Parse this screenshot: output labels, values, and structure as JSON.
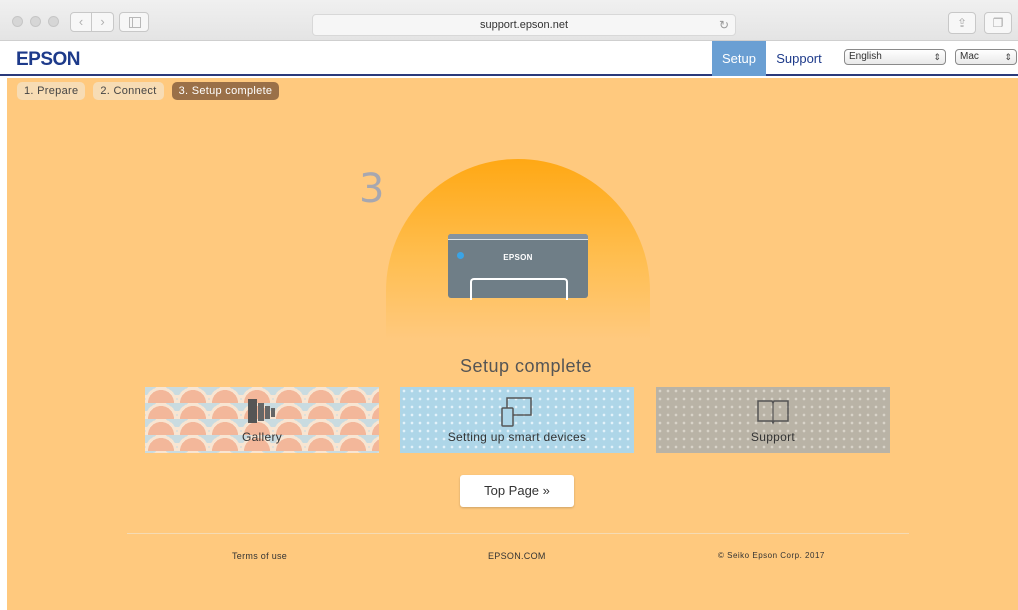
{
  "browser": {
    "url": "support.epson.net"
  },
  "header": {
    "logo": "EPSON",
    "tabs": [
      {
        "label": "Setup",
        "active": true
      },
      {
        "label": "Support",
        "active": false
      }
    ],
    "language_select": "English",
    "os_select": "Mac"
  },
  "steps": [
    {
      "label": "1. Prepare",
      "active": false
    },
    {
      "label": "2. Connect",
      "active": false
    },
    {
      "label": "3. Setup complete",
      "active": true
    }
  ],
  "hero": {
    "step_number": "3",
    "printer_label": "EPSON",
    "heading": "Setup complete"
  },
  "tiles": [
    {
      "label": "Gallery",
      "icon": "gallery-icon"
    },
    {
      "label": "Setting up smart devices",
      "icon": "smart-devices-icon"
    },
    {
      "label": "Support",
      "icon": "book-icon"
    }
  ],
  "top_page_button": "Top Page »",
  "footer": {
    "terms": "Terms of use",
    "site": "EPSON.COM",
    "copyright": "© Seiko Epson Corp. 2017"
  },
  "colors": {
    "background": "#ffc97e",
    "accent_tab": "#6a9fd3",
    "brand": "#1d3a8a",
    "active_step": "#9a7048"
  }
}
